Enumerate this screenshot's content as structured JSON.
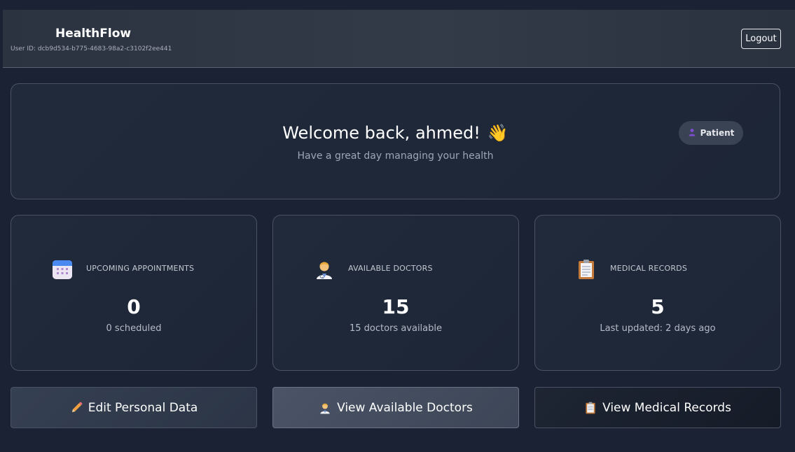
{
  "header": {
    "brand": "HealthFlow",
    "user_id": "User ID: dcb9d534-b775-4683-98a2-c3102f2ee441",
    "logout_label": "Logout"
  },
  "welcome": {
    "title": "Welcome back, ahmed!",
    "wave_emoji": "👋",
    "subtitle": "Have a great day managing your health",
    "role_badge": "Patient",
    "role_icon": "person-icon"
  },
  "stats": [
    {
      "icon": "calendar-icon",
      "label": "UPCOMING APPOINTMENTS",
      "value": "0",
      "sub": "0 scheduled"
    },
    {
      "icon": "doctor-icon",
      "label": "AVAILABLE DOCTORS",
      "value": "15",
      "sub": "15 doctors available"
    },
    {
      "icon": "clipboard-icon",
      "label": "MEDICAL RECORDS",
      "value": "5",
      "sub": "Last updated: 2 days ago"
    }
  ],
  "actions": [
    {
      "icon": "pencil-icon",
      "label": "Edit Personal Data"
    },
    {
      "icon": "doctor-icon",
      "label": "View Available Doctors"
    },
    {
      "icon": "clipboard-icon",
      "label": "View Medical Records"
    }
  ],
  "colors": {
    "background": "#1a2233",
    "card": "#202a3a",
    "accent_purple": "#7c4dcc"
  }
}
